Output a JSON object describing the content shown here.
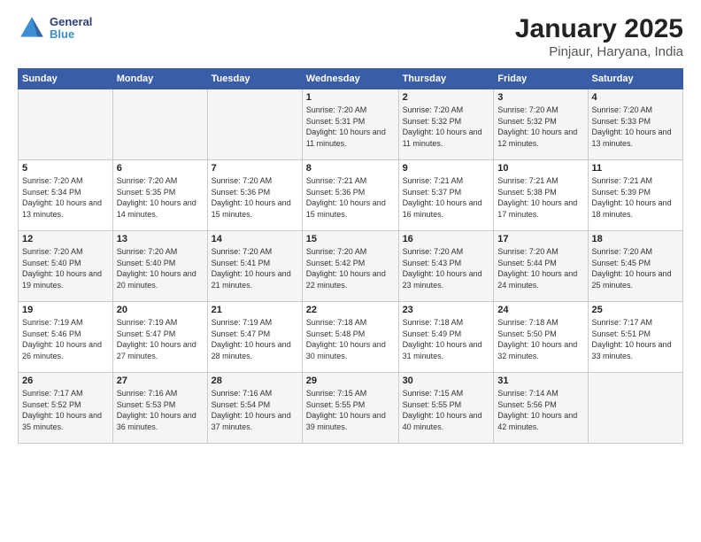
{
  "header": {
    "logo_line1": "General",
    "logo_line2": "Blue",
    "title": "January 2025",
    "subtitle": "Pinjaur, Haryana, India"
  },
  "days_of_week": [
    "Sunday",
    "Monday",
    "Tuesday",
    "Wednesday",
    "Thursday",
    "Friday",
    "Saturday"
  ],
  "weeks": [
    [
      {
        "day": "",
        "info": ""
      },
      {
        "day": "",
        "info": ""
      },
      {
        "day": "",
        "info": ""
      },
      {
        "day": "1",
        "info": "Sunrise: 7:20 AM\nSunset: 5:31 PM\nDaylight: 10 hours\nand 11 minutes."
      },
      {
        "day": "2",
        "info": "Sunrise: 7:20 AM\nSunset: 5:32 PM\nDaylight: 10 hours\nand 11 minutes."
      },
      {
        "day": "3",
        "info": "Sunrise: 7:20 AM\nSunset: 5:32 PM\nDaylight: 10 hours\nand 12 minutes."
      },
      {
        "day": "4",
        "info": "Sunrise: 7:20 AM\nSunset: 5:33 PM\nDaylight: 10 hours\nand 13 minutes."
      }
    ],
    [
      {
        "day": "5",
        "info": "Sunrise: 7:20 AM\nSunset: 5:34 PM\nDaylight: 10 hours\nand 13 minutes."
      },
      {
        "day": "6",
        "info": "Sunrise: 7:20 AM\nSunset: 5:35 PM\nDaylight: 10 hours\nand 14 minutes."
      },
      {
        "day": "7",
        "info": "Sunrise: 7:20 AM\nSunset: 5:36 PM\nDaylight: 10 hours\nand 15 minutes."
      },
      {
        "day": "8",
        "info": "Sunrise: 7:21 AM\nSunset: 5:36 PM\nDaylight: 10 hours\nand 15 minutes."
      },
      {
        "day": "9",
        "info": "Sunrise: 7:21 AM\nSunset: 5:37 PM\nDaylight: 10 hours\nand 16 minutes."
      },
      {
        "day": "10",
        "info": "Sunrise: 7:21 AM\nSunset: 5:38 PM\nDaylight: 10 hours\nand 17 minutes."
      },
      {
        "day": "11",
        "info": "Sunrise: 7:21 AM\nSunset: 5:39 PM\nDaylight: 10 hours\nand 18 minutes."
      }
    ],
    [
      {
        "day": "12",
        "info": "Sunrise: 7:20 AM\nSunset: 5:40 PM\nDaylight: 10 hours\nand 19 minutes."
      },
      {
        "day": "13",
        "info": "Sunrise: 7:20 AM\nSunset: 5:40 PM\nDaylight: 10 hours\nand 20 minutes."
      },
      {
        "day": "14",
        "info": "Sunrise: 7:20 AM\nSunset: 5:41 PM\nDaylight: 10 hours\nand 21 minutes."
      },
      {
        "day": "15",
        "info": "Sunrise: 7:20 AM\nSunset: 5:42 PM\nDaylight: 10 hours\nand 22 minutes."
      },
      {
        "day": "16",
        "info": "Sunrise: 7:20 AM\nSunset: 5:43 PM\nDaylight: 10 hours\nand 23 minutes."
      },
      {
        "day": "17",
        "info": "Sunrise: 7:20 AM\nSunset: 5:44 PM\nDaylight: 10 hours\nand 24 minutes."
      },
      {
        "day": "18",
        "info": "Sunrise: 7:20 AM\nSunset: 5:45 PM\nDaylight: 10 hours\nand 25 minutes."
      }
    ],
    [
      {
        "day": "19",
        "info": "Sunrise: 7:19 AM\nSunset: 5:46 PM\nDaylight: 10 hours\nand 26 minutes."
      },
      {
        "day": "20",
        "info": "Sunrise: 7:19 AM\nSunset: 5:47 PM\nDaylight: 10 hours\nand 27 minutes."
      },
      {
        "day": "21",
        "info": "Sunrise: 7:19 AM\nSunset: 5:47 PM\nDaylight: 10 hours\nand 28 minutes."
      },
      {
        "day": "22",
        "info": "Sunrise: 7:18 AM\nSunset: 5:48 PM\nDaylight: 10 hours\nand 30 minutes."
      },
      {
        "day": "23",
        "info": "Sunrise: 7:18 AM\nSunset: 5:49 PM\nDaylight: 10 hours\nand 31 minutes."
      },
      {
        "day": "24",
        "info": "Sunrise: 7:18 AM\nSunset: 5:50 PM\nDaylight: 10 hours\nand 32 minutes."
      },
      {
        "day": "25",
        "info": "Sunrise: 7:17 AM\nSunset: 5:51 PM\nDaylight: 10 hours\nand 33 minutes."
      }
    ],
    [
      {
        "day": "26",
        "info": "Sunrise: 7:17 AM\nSunset: 5:52 PM\nDaylight: 10 hours\nand 35 minutes."
      },
      {
        "day": "27",
        "info": "Sunrise: 7:16 AM\nSunset: 5:53 PM\nDaylight: 10 hours\nand 36 minutes."
      },
      {
        "day": "28",
        "info": "Sunrise: 7:16 AM\nSunset: 5:54 PM\nDaylight: 10 hours\nand 37 minutes."
      },
      {
        "day": "29",
        "info": "Sunrise: 7:15 AM\nSunset: 5:55 PM\nDaylight: 10 hours\nand 39 minutes."
      },
      {
        "day": "30",
        "info": "Sunrise: 7:15 AM\nSunset: 5:55 PM\nDaylight: 10 hours\nand 40 minutes."
      },
      {
        "day": "31",
        "info": "Sunrise: 7:14 AM\nSunset: 5:56 PM\nDaylight: 10 hours\nand 42 minutes."
      },
      {
        "day": "",
        "info": ""
      }
    ]
  ]
}
